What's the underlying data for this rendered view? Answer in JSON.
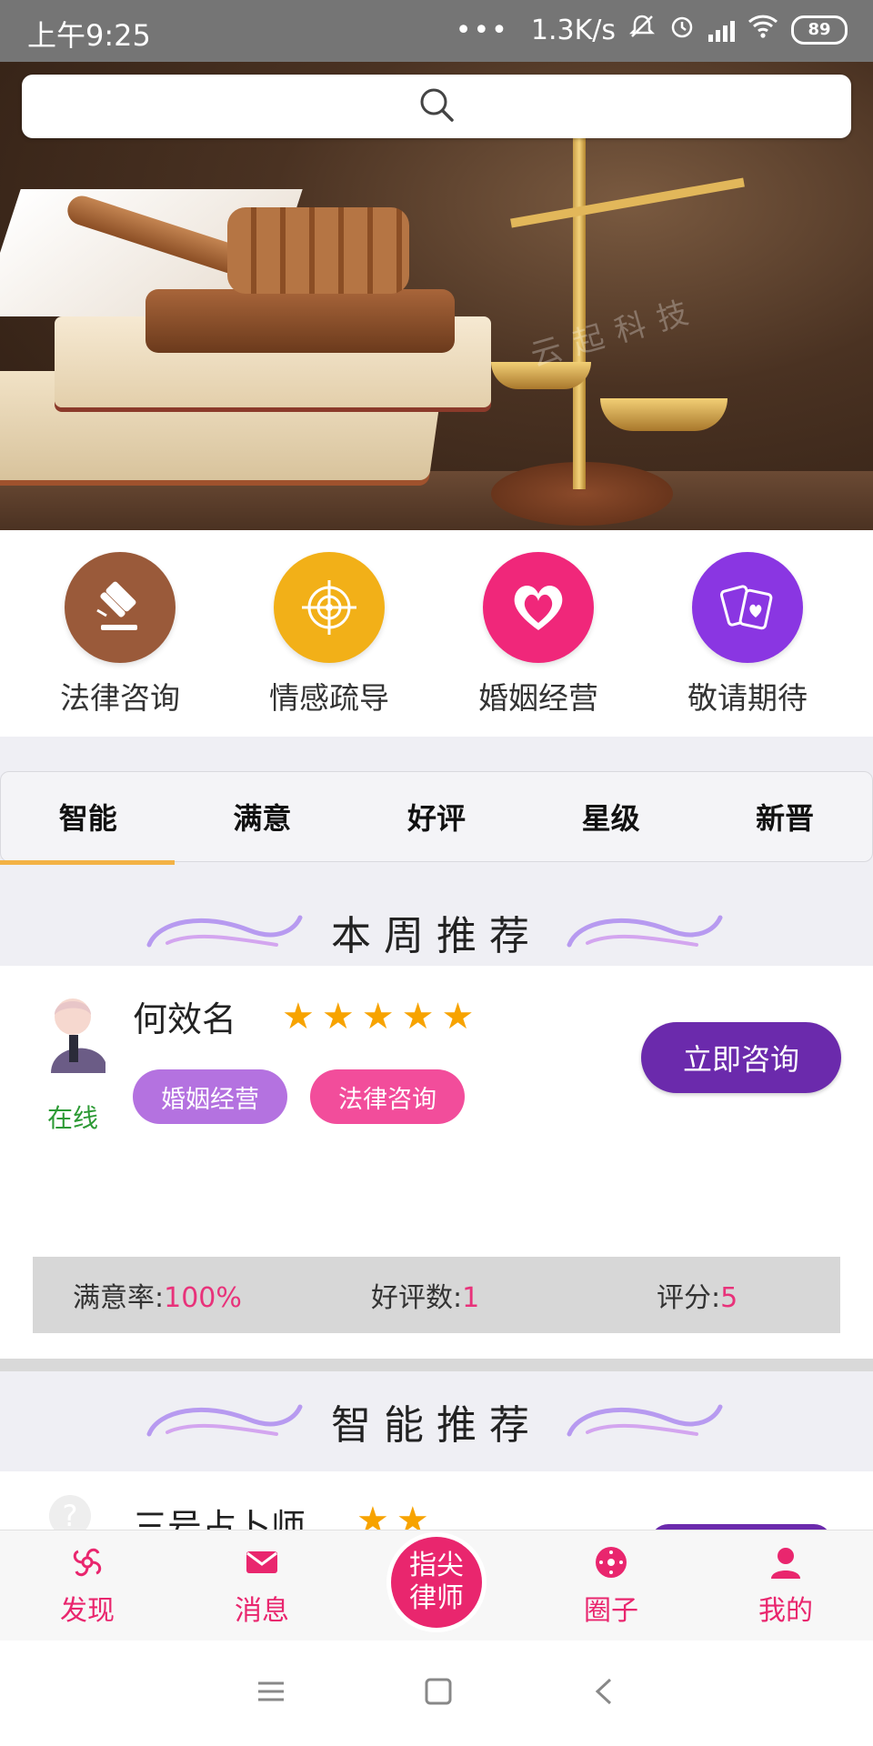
{
  "status_bar": {
    "time": "上午9:25",
    "dots": "•••",
    "speed": "1.3K/s",
    "battery": "89"
  },
  "banner": {
    "watermark": "云起科技"
  },
  "categories": [
    {
      "label": "法律咨询",
      "icon": "gavel-icon",
      "color": "#9a5a3a"
    },
    {
      "label": "情感疏导",
      "icon": "target-icon",
      "color": "#f2b018"
    },
    {
      "label": "婚姻经营",
      "icon": "heart-icon",
      "color": "#f0277a"
    },
    {
      "label": "敬请期待",
      "icon": "cards-heart-icon",
      "color": "#8a36e2"
    }
  ],
  "tabs": [
    "智能",
    "满意",
    "好评",
    "星级",
    "新晋"
  ],
  "weekly": {
    "title": "本周推荐"
  },
  "card": {
    "name": "何效名",
    "stars": 5,
    "status": "在线",
    "tags": [
      "婚姻经营",
      "法律咨询"
    ],
    "button": "立即咨询",
    "stats": {
      "satisfaction_label": "满意率:",
      "satisfaction_value": "100%",
      "reviews_label": "好评数:",
      "reviews_value": "1",
      "score_label": "评分:",
      "score_value": "5"
    }
  },
  "smart": {
    "title": "智能推荐"
  },
  "card2": {
    "name": "三号占卜师",
    "stars": 2
  },
  "tabbar": {
    "discover": "发现",
    "messages": "消息",
    "center_line1": "指尖",
    "center_line2": "律师",
    "circle": "圈子",
    "mine": "我的"
  },
  "colors": {
    "accent": "#e9266e",
    "button": "#6b2aac",
    "tab_underline": "#f3b245"
  }
}
